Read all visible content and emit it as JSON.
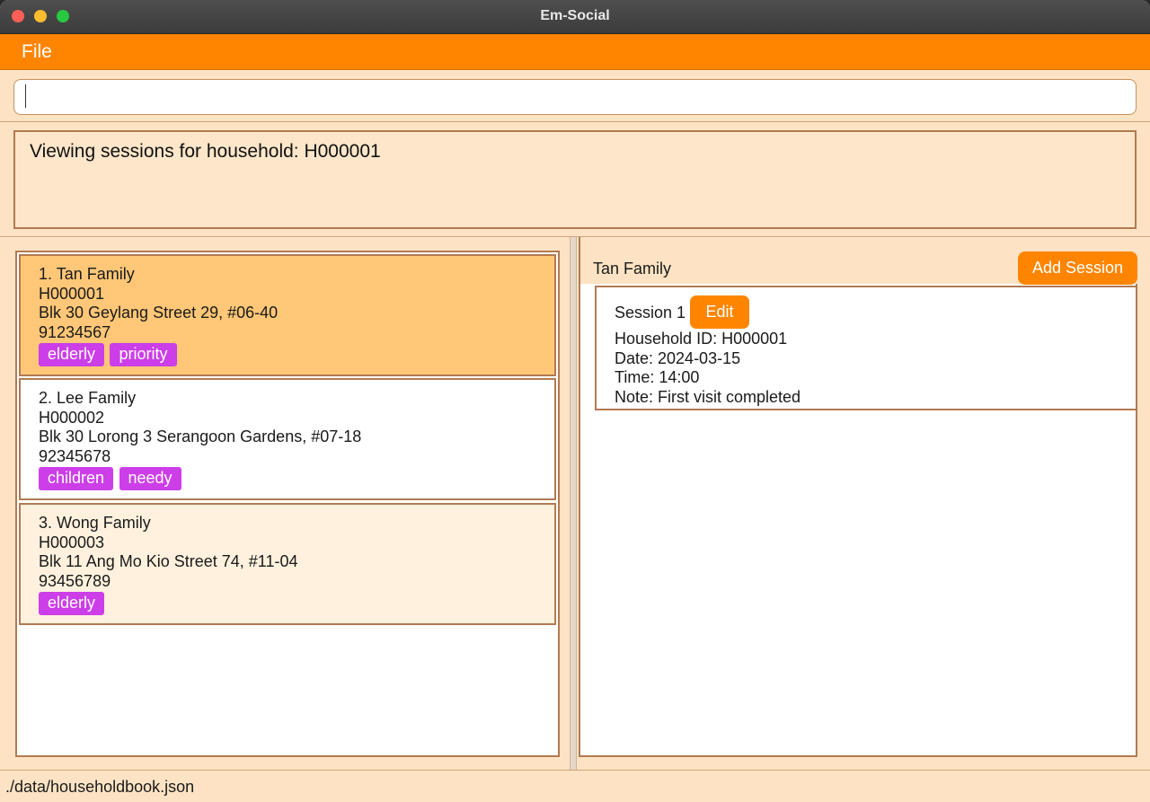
{
  "window": {
    "title": "Em-Social"
  },
  "menu": {
    "file_label": "File"
  },
  "command": {
    "value": "",
    "placeholder": ""
  },
  "result": {
    "text": "Viewing sessions for household: H000001"
  },
  "households": [
    {
      "index": "1.",
      "name": "Tan Family",
      "id": "H000001",
      "address": "Blk 30 Geylang Street 29, #06-40",
      "phone": "91234567",
      "tags": [
        "elderly",
        "priority"
      ]
    },
    {
      "index": "2.",
      "name": "Lee Family",
      "id": "H000002",
      "address": "Blk 30 Lorong 3 Serangoon Gardens, #07-18",
      "phone": "92345678",
      "tags": [
        "children",
        "needy"
      ]
    },
    {
      "index": "3.",
      "name": "Wong Family",
      "id": "H000003",
      "address": "Blk 11 Ang Mo Kio Street 74, #11-04",
      "phone": "93456789",
      "tags": [
        "elderly"
      ]
    }
  ],
  "detail": {
    "household_name": "Tan Family",
    "add_session_label": "Add Session",
    "sessions": [
      {
        "title": "Session 1",
        "edit_label": "Edit",
        "household_id": "Household ID: H000001",
        "date": "Date: 2024-03-15",
        "time": "Time: 14:00",
        "note": "Note: First visit completed"
      }
    ]
  },
  "status": {
    "path": "./data/householdbook.json"
  },
  "colors": {
    "accent": "#ff8500",
    "tag": "#cc3ee8",
    "selected_card": "#ffc777",
    "border": "#b27a52"
  }
}
